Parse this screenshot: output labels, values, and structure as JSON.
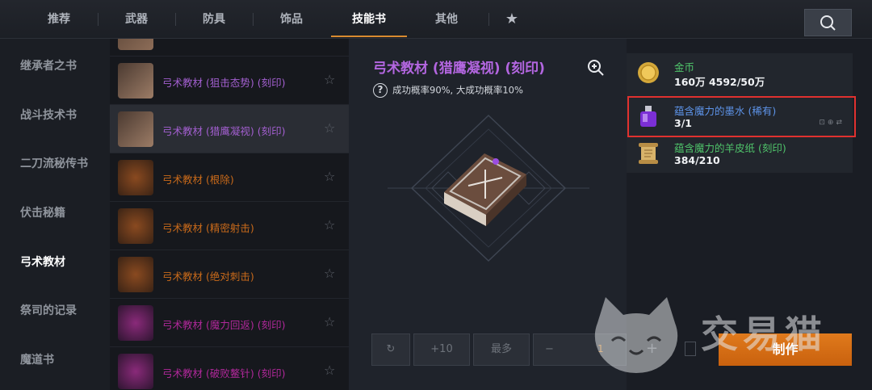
{
  "tabs": [
    {
      "label": "推荐"
    },
    {
      "label": "武器"
    },
    {
      "label": "防具"
    },
    {
      "label": "饰品"
    },
    {
      "label": "技能书"
    },
    {
      "label": "其他"
    }
  ],
  "active_tab": "技能书",
  "sidebar": {
    "items": [
      {
        "label": "继承者之书"
      },
      {
        "label": "战斗技术书"
      },
      {
        "label": "二刀流秘传书"
      },
      {
        "label": "伏击秘籍"
      },
      {
        "label": "弓术教材"
      },
      {
        "label": "祭司的记录"
      },
      {
        "label": "魔道书"
      }
    ]
  },
  "list": {
    "items": [
      {
        "label": "弓术教材 (狙击态势) (刻印)",
        "color": "#a35fd0",
        "rarity": "epic"
      },
      {
        "label": "弓术教材 (猎鹰凝视) (刻印)",
        "color": "#a35fd0",
        "rarity": "epic"
      },
      {
        "label": "弓术教材 (根除)",
        "color": "#c96a1a",
        "rarity": "legendary"
      },
      {
        "label": "弓术教材 (精密射击)",
        "color": "#c96a1a",
        "rarity": "legendary"
      },
      {
        "label": "弓术教材 (绝对刺击)",
        "color": "#c96a1a",
        "rarity": "legendary"
      },
      {
        "label": "弓术教材 (魔力回返) (刻印)",
        "color": "#b0289a",
        "rarity": "mythic"
      },
      {
        "label": "弓术教材 (破败鳌针) (刻印)",
        "color": "#b0289a",
        "rarity": "mythic"
      }
    ]
  },
  "detail": {
    "title": "弓术教材 (猎鹰凝视) (刻印)",
    "rate_text": "成功概率90%, 大成功概率10%"
  },
  "materials": [
    {
      "name": "金币",
      "count": "160万 4592/50万",
      "name_color": "#4fc36a",
      "icon": "gold-coin-icon"
    },
    {
      "name": "蕴含魔力的墨水 (稀有)",
      "count": "3/1",
      "name_color": "#5d93e8",
      "icon": "ink-bottle-icon"
    },
    {
      "name": "蕴含魔力的羊皮纸 (刻印)",
      "count": "384/210",
      "name_color": "#4fc36a",
      "icon": "parchment-scroll-icon"
    }
  ],
  "controls": {
    "refresh_icon": "refresh-icon",
    "plus10": "+10",
    "max": "最多",
    "minus": "−",
    "quantity": "1",
    "plus": "+",
    "craft": "制作"
  },
  "watermark": {
    "text": "交易猫"
  },
  "colors": {
    "accent": "#d98a2f",
    "craft": "#e07a1c",
    "highlight": "#e0312f"
  }
}
